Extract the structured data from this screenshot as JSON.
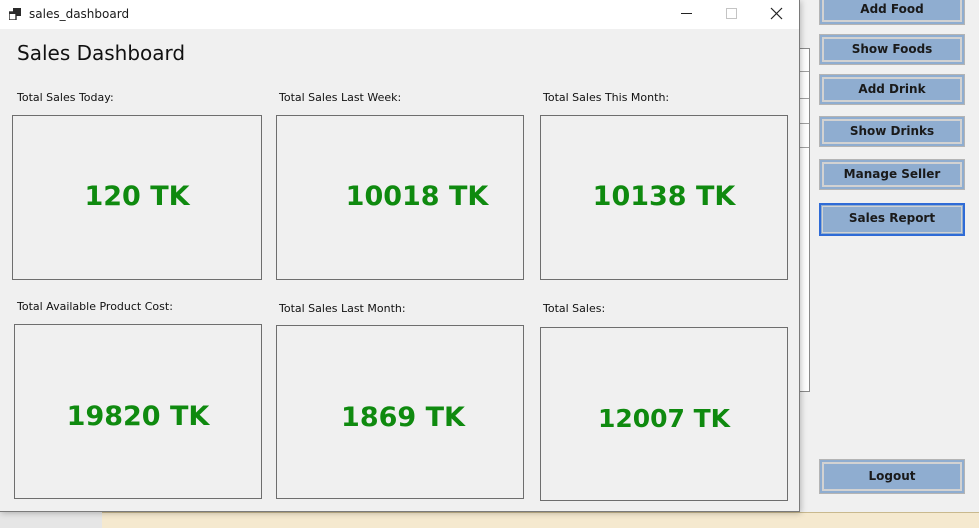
{
  "window": {
    "title": "sales_dashboard"
  },
  "dashboard": {
    "heading": "Sales Dashboard",
    "value_color": "#0f8a0f",
    "cards": [
      {
        "label": "Total Sales Today:",
        "value": "120 TK"
      },
      {
        "label": "Total Sales Last Week:",
        "value": "10018 TK"
      },
      {
        "label": "Total Sales This Month:",
        "value": "10138 TK"
      },
      {
        "label": "Total Available Product Cost:",
        "value": "19820 TK"
      },
      {
        "label": "Total Sales Last Month:",
        "value": "1869 TK"
      },
      {
        "label": "Total Sales:",
        "value": "12007 TK"
      }
    ]
  },
  "sidebar": {
    "button_color": "#8fadd0",
    "active_border_color": "#2f6bd6",
    "buttons": [
      {
        "label": "Add Food"
      },
      {
        "label": "Show Foods"
      },
      {
        "label": "Add Drink"
      },
      {
        "label": "Show Drinks"
      },
      {
        "label": "Manage Seller"
      },
      {
        "label": "Sales Report",
        "active": true
      }
    ],
    "logout_label": "Logout"
  },
  "icons": {
    "app": "app-window-icon",
    "minimize": "minimize-icon",
    "maximize": "maximize-icon",
    "close": "close-icon"
  }
}
